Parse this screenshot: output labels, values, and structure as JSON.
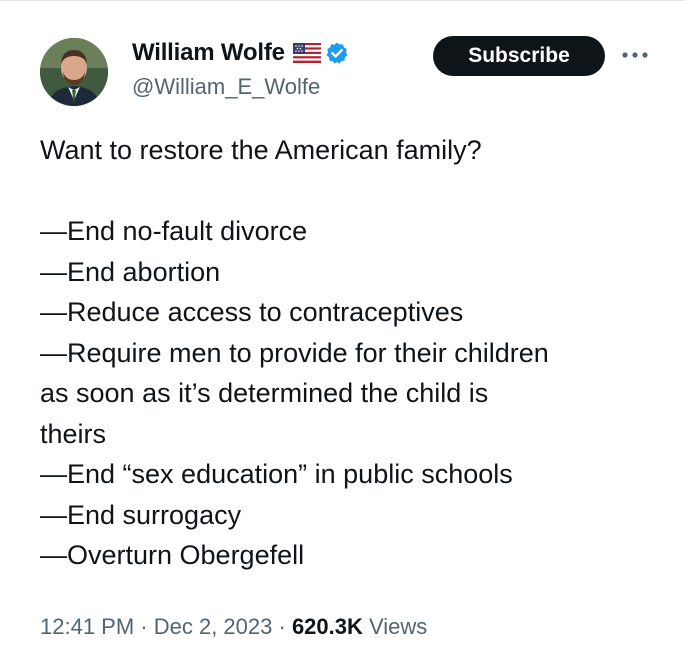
{
  "author": {
    "display_name": "William Wolfe",
    "handle": "@William_E_Wolfe",
    "flag_icon": "us-flag-icon",
    "verified_icon": "verified-badge-icon",
    "verified_color": "#1d9bf0"
  },
  "actions": {
    "subscribe_label": "Subscribe",
    "more_icon": "more-horizontal-icon"
  },
  "tweet": {
    "lines": [
      "Want to restore the American family?",
      "",
      "—End no-fault divorce",
      "—End abortion",
      "—Reduce access to contraceptives",
      "—Require men to provide for their children",
      "as soon as it’s determined the child is",
      "theirs",
      "—End “sex education” in public schools",
      "—End surrogacy",
      "—Overturn Obergefell"
    ]
  },
  "meta": {
    "time": "12:41 PM",
    "separator": " · ",
    "date": "Dec 2, 2023",
    "views_count": "620.3K",
    "views_label": "Views"
  }
}
